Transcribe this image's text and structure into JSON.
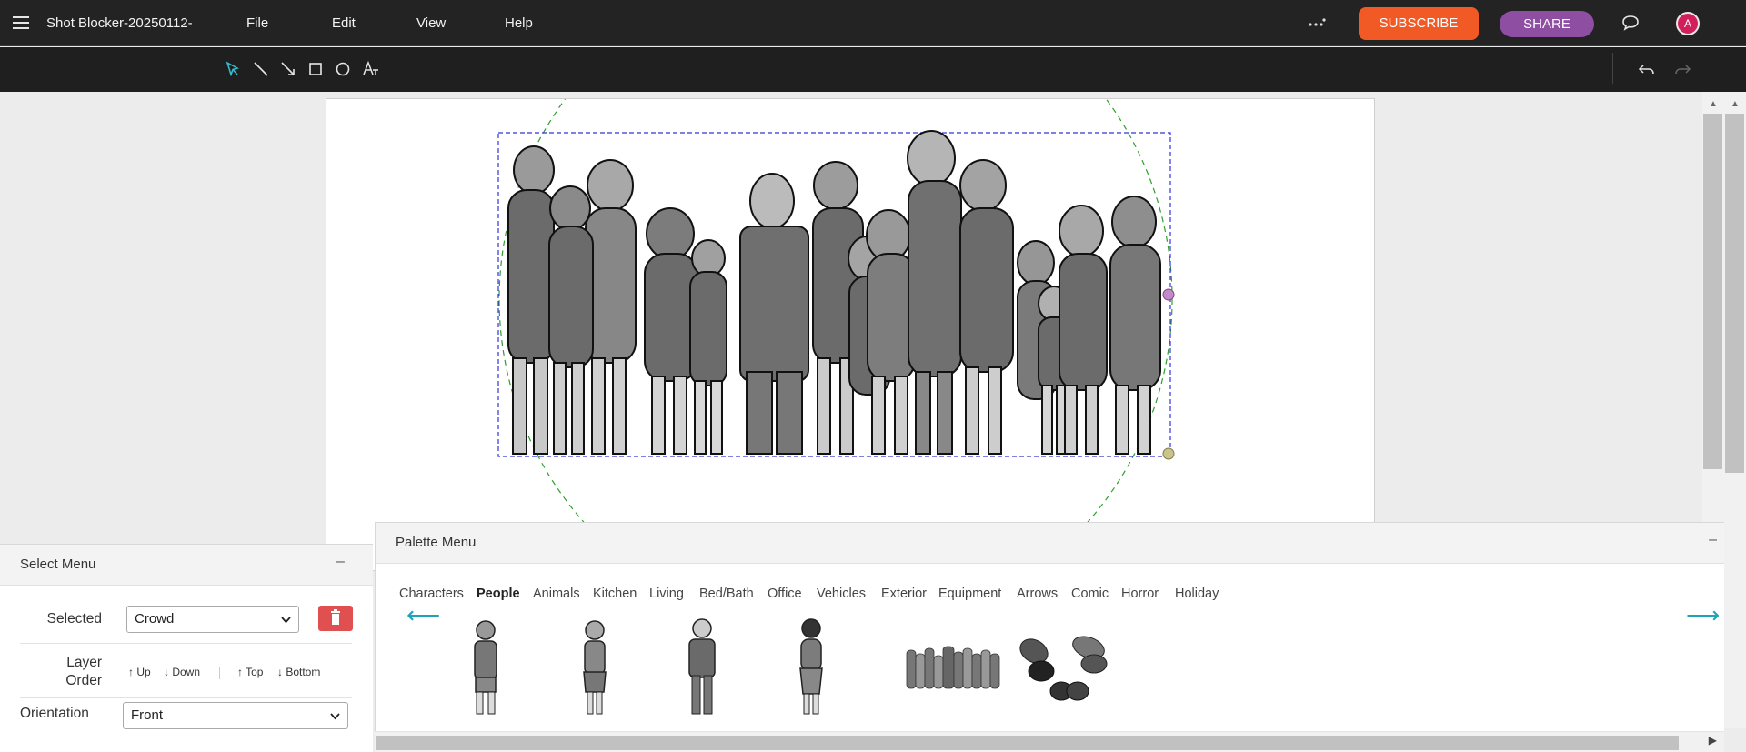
{
  "app": {
    "doc_title": "Shot Blocker-20250112-",
    "menu": [
      "File",
      "Edit",
      "View",
      "Help"
    ],
    "subscribe_label": "SUBSCRIBE",
    "share_label": "SHARE",
    "avatar_initial": "A",
    "colors": {
      "subscribe": "#f15a24",
      "share": "#8e4fa3",
      "avatar": "#d21f5b",
      "accent": "#1fa3b8",
      "delete": "#e05050"
    }
  },
  "toolbar": {
    "tools": [
      "select-icon",
      "line-icon",
      "arrow-icon",
      "rectangle-icon",
      "circle-icon",
      "text-icon"
    ],
    "history": [
      "undo-icon",
      "redo-icon"
    ]
  },
  "palette": {
    "title": "Palette Menu",
    "minimize": "–",
    "categories": [
      "Characters",
      "People",
      "Animals",
      "Kitchen",
      "Living",
      "Bed/Bath",
      "Office",
      "Vehicles",
      "Exterior",
      "Equipment",
      "Arrows",
      "Comic",
      "Horror",
      "Holiday"
    ],
    "active_category": "People",
    "prev_arrow": "⟵",
    "next_arrow": "⟶",
    "items": [
      "boy-figure",
      "girl-figure",
      "man-figure",
      "woman-figure",
      "crowd-figure",
      "crowd-top-view-figure"
    ]
  },
  "select_menu": {
    "title": "Select Menu",
    "minimize": "–",
    "selected_label": "Selected",
    "selected_value": "Crowd",
    "layer_order_label_1": "Layer",
    "layer_order_label_2": "Order",
    "order_up": "↑ Up",
    "order_down": "↓ Down",
    "order_top": "↑ Top",
    "order_bottom": "↓ Bottom",
    "orientation_label": "Orientation",
    "orientation_value": "Front"
  },
  "canvas": {
    "selected_object": "Crowd"
  }
}
